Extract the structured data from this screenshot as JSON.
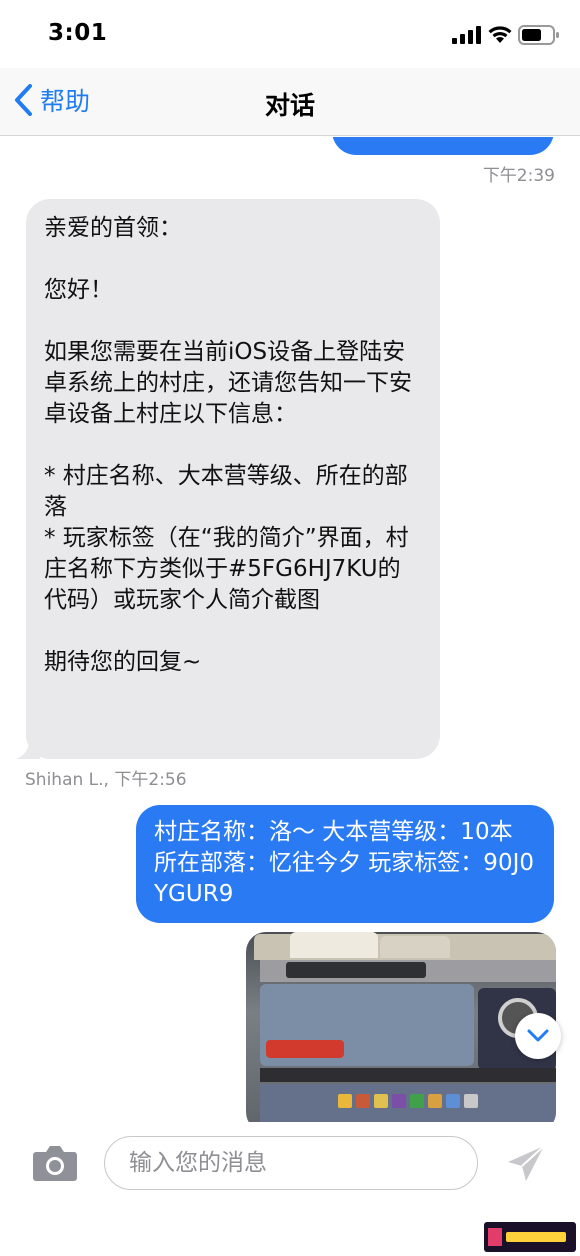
{
  "status_bar": {
    "time": "3:01"
  },
  "nav": {
    "back_label": "帮助",
    "title": "对话"
  },
  "messages": {
    "top_timestamp": "下午2:39",
    "incoming": {
      "text": "亲爱的首领：\n\n您好！\n\n如果您需要在当前iOS设备上登陆安卓系统上的村庄，还请您告知一下安卓设备上村庄以下信息：\n\n* 村庄名称、大本营等级、所在的部落\n* 玩家标签（在“我的简介”界面，村庄名称下方类似于#5FG6HJ7KU的代码）或玩家个人简介截图\n\n期待您的回复~",
      "sender_time": "Shihan L., 下午2:56"
    },
    "outgoing": {
      "text": "村庄名称：洛～ 大本营等级：10本 所在部落：忆往今夕 玩家标签：90J0YGUR9"
    }
  },
  "input": {
    "placeholder": "输入您的消息",
    "value": ""
  },
  "colors": {
    "accent": "#1f7cf2",
    "outgoing_bubble": "#2a7bf3",
    "incoming_bubble": "#e9e9eb"
  },
  "icons": {
    "back": "chevron-left-icon",
    "camera": "camera-icon",
    "send": "send-icon",
    "scroll": "chevron-down-icon"
  }
}
